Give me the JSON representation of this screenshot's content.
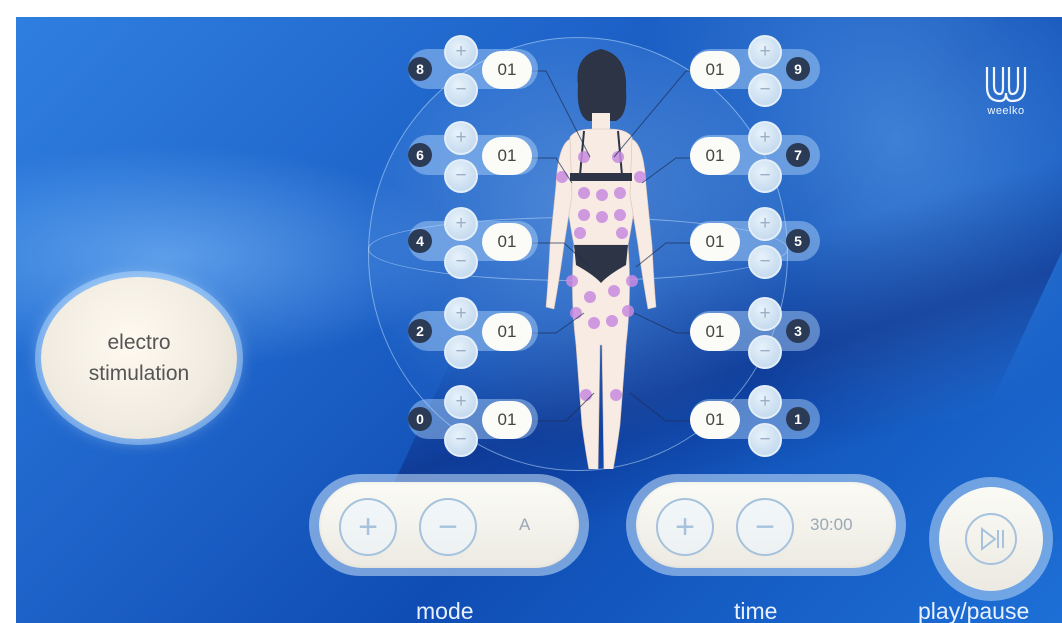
{
  "brand": {
    "logo_text": "weelko"
  },
  "main_button": {
    "line1": "electro",
    "line2": "stimulation"
  },
  "channels": {
    "left": [
      {
        "number": "8",
        "value": "01"
      },
      {
        "number": "6",
        "value": "01"
      },
      {
        "number": "4",
        "value": "01"
      },
      {
        "number": "2",
        "value": "01"
      },
      {
        "number": "0",
        "value": "01"
      }
    ],
    "right": [
      {
        "number": "9",
        "value": "01"
      },
      {
        "number": "7",
        "value": "01"
      },
      {
        "number": "5",
        "value": "01"
      },
      {
        "number": "3",
        "value": "01"
      },
      {
        "number": "1",
        "value": "01"
      }
    ],
    "plus_symbol": "+",
    "minus_symbol": "−"
  },
  "mode": {
    "label": "mode",
    "value": "A",
    "plus": "+",
    "minus": "−"
  },
  "time": {
    "label": "time",
    "value": "30:00",
    "plus": "+",
    "minus": "−"
  },
  "play": {
    "label": "play/pause",
    "icon": "play-pause-icon"
  },
  "colors": {
    "background": "#1e63c9",
    "panel": "#fbfbf6",
    "electrode": "#c98be0"
  }
}
